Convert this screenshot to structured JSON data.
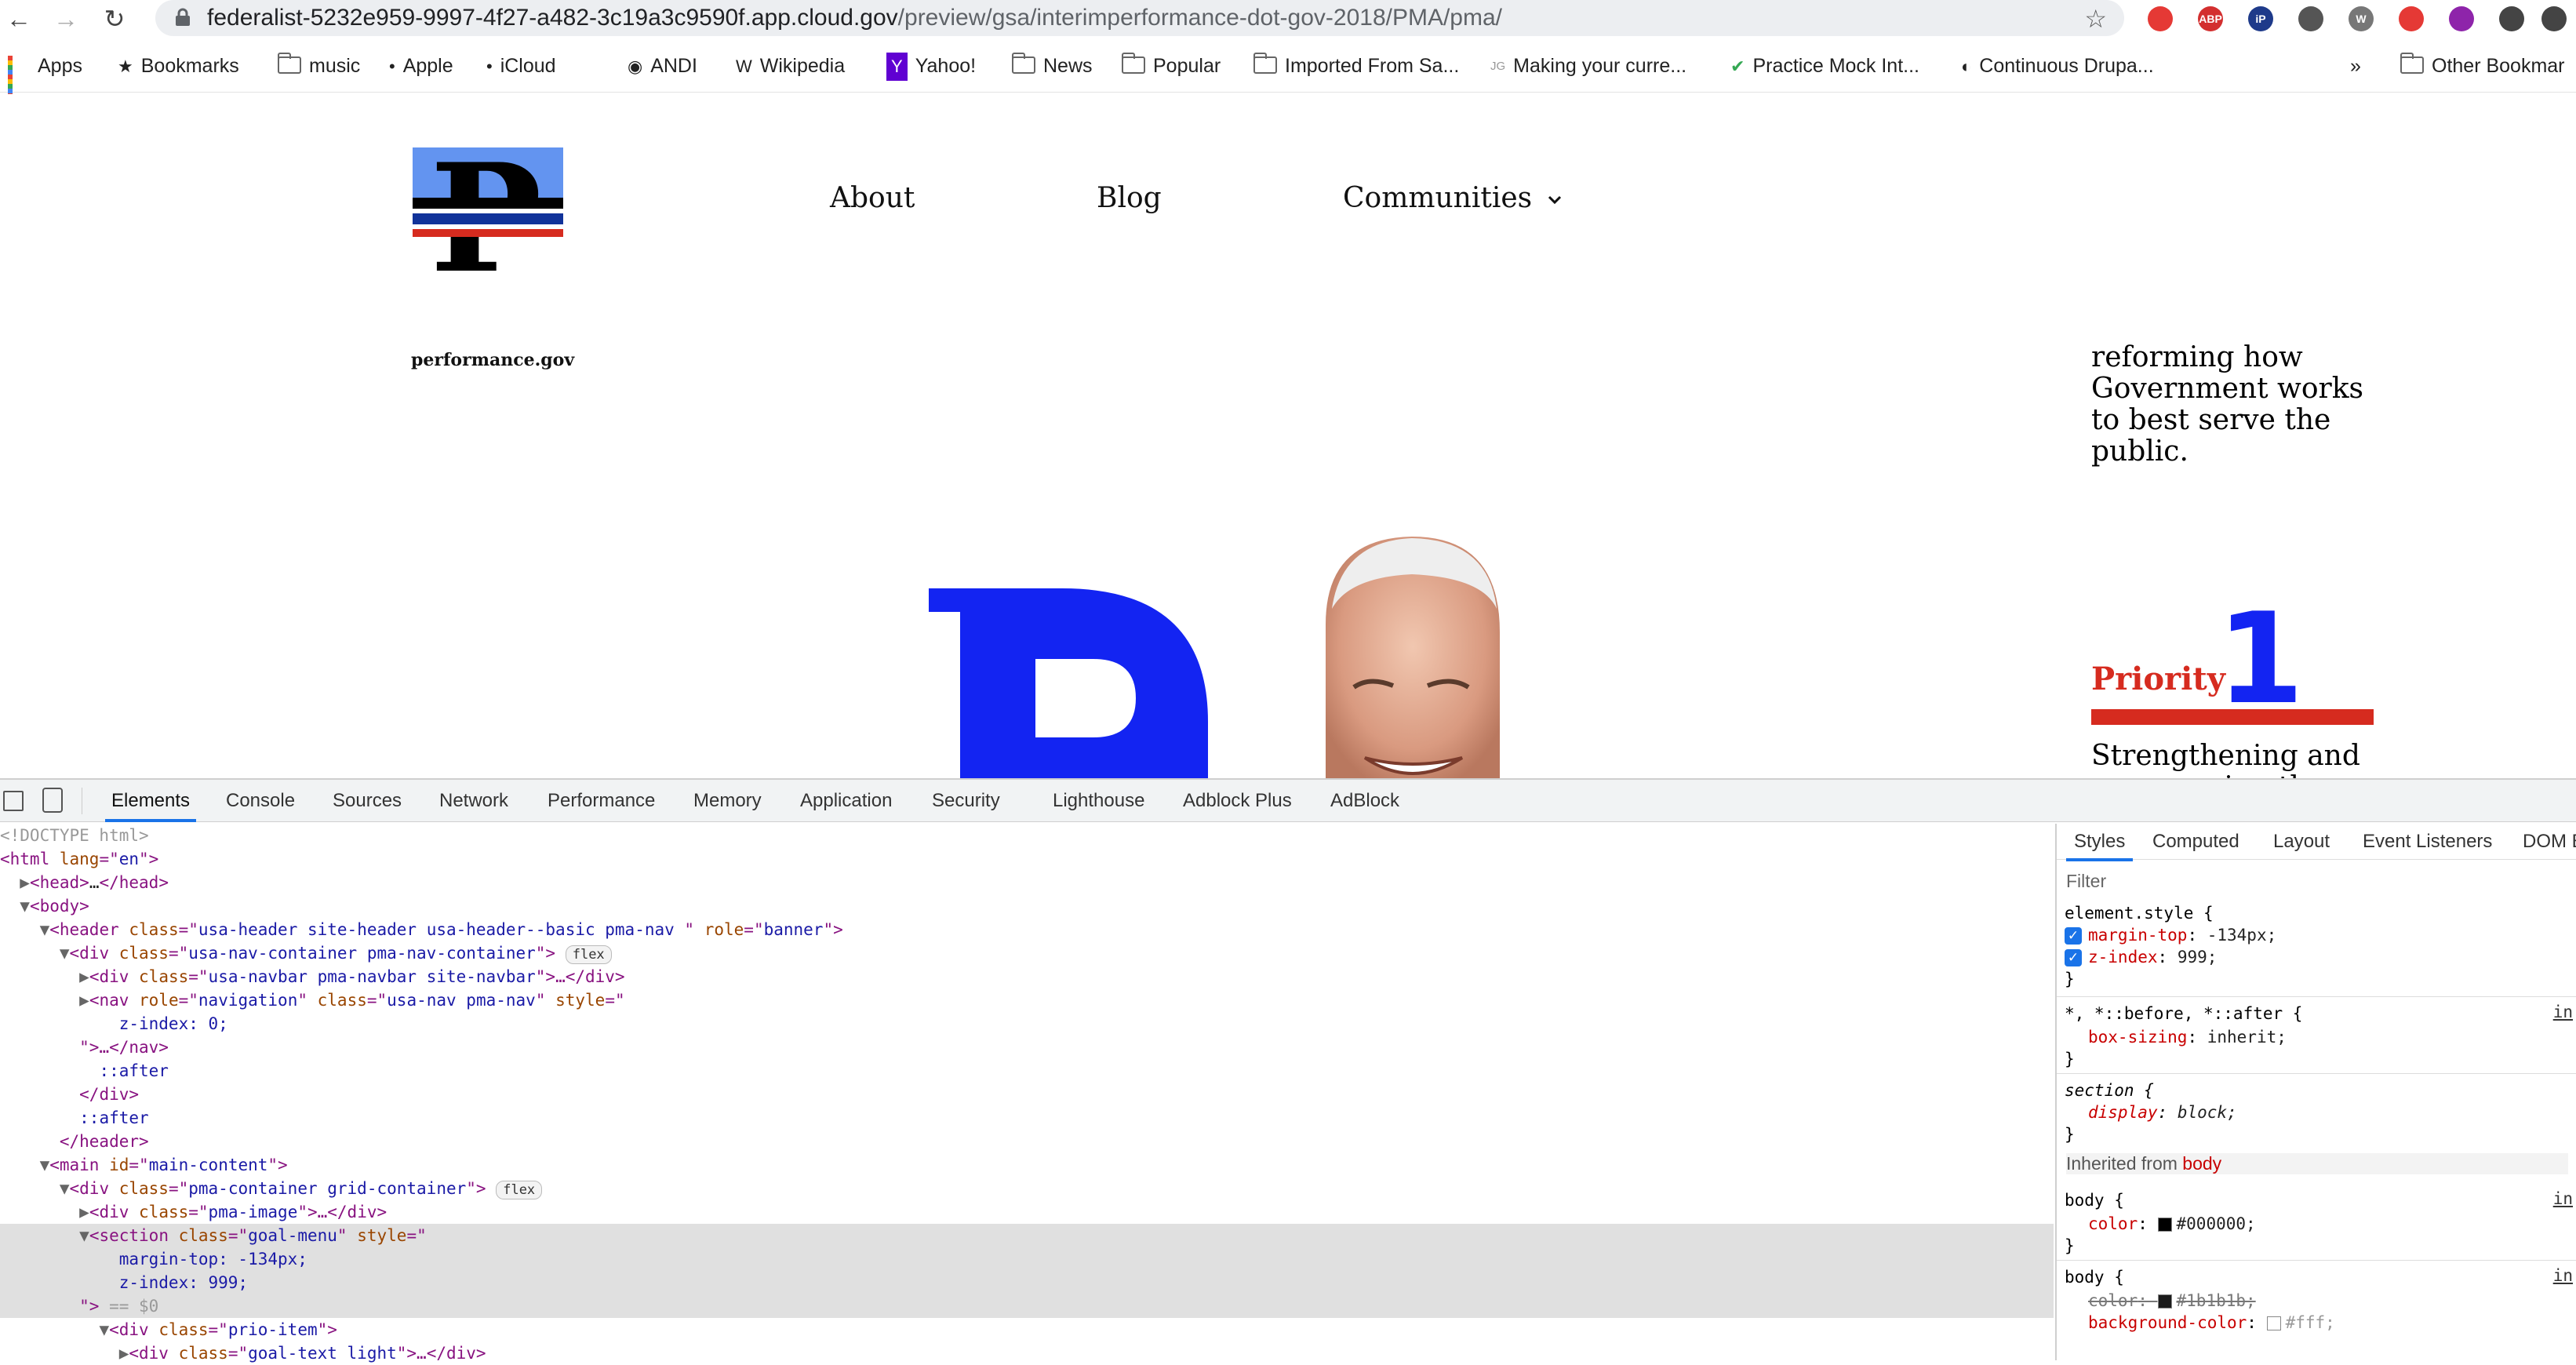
{
  "browser": {
    "url_host": "federalist-5232e959-9997-4f27-a482-3c19a3c9590f.app.cloud.gov",
    "url_path": "/preview/gsa/interimperformance-dot-gov-2018/PMA/pma/",
    "bookmarks": [
      {
        "label": "Apps",
        "icon": "apps-grid-icon"
      },
      {
        "label": "Bookmarks",
        "icon": "star-icon"
      },
      {
        "label": "music",
        "icon": "folder-icon"
      },
      {
        "label": "Apple",
        "icon": "apple-icon"
      },
      {
        "label": "iCloud",
        "icon": "apple-icon"
      },
      {
        "label": "ANDI",
        "icon": "globe-icon"
      },
      {
        "label": "Wikipedia",
        "icon": "wikipedia-icon"
      },
      {
        "label": "Yahoo!",
        "icon": "yahoo-icon"
      },
      {
        "label": "News",
        "icon": "folder-icon"
      },
      {
        "label": "Popular",
        "icon": "folder-icon"
      },
      {
        "label": "Imported From Sa...",
        "icon": "folder-icon"
      },
      {
        "label": "Making your curre...",
        "icon": "jg-icon"
      },
      {
        "label": "Practice Mock Int...",
        "icon": "check-circle-icon"
      },
      {
        "label": "Continuous Drupa...",
        "icon": "drupal-icon"
      }
    ],
    "overflow_label": "»",
    "other_bookmarks": "Other Bookmar",
    "extensions": [
      {
        "text": "",
        "color": "#e53935"
      },
      {
        "text": "ABP",
        "color": "#d32f2f"
      },
      {
        "text": "iP",
        "color": "#1e3a8a"
      },
      {
        "text": "",
        "color": "#555555"
      },
      {
        "text": "W",
        "color": "#777777"
      },
      {
        "text": "",
        "color": "#e53935"
      },
      {
        "text": "",
        "color": "#8e24aa"
      },
      {
        "text": "",
        "color": "#444444"
      },
      {
        "text": "",
        "color": "#444444"
      }
    ]
  },
  "site": {
    "logo_word": "performance.gov",
    "nav": [
      {
        "label": "About"
      },
      {
        "label": "Blog"
      },
      {
        "label": "Communities"
      }
    ],
    "goal_intro": "reforming how Government works to best serve the public.",
    "priority_word": "Priority",
    "priority_number": "1",
    "goal_title": "Strengthening and empowering the Federal workforce",
    "colors": {
      "blue": "#1324f2",
      "red": "#d62b1f",
      "logo_sky": "#6394f0"
    }
  },
  "devtools": {
    "tabs": [
      "Elements",
      "Console",
      "Sources",
      "Network",
      "Performance",
      "Memory",
      "Application",
      "Security",
      "Lighthouse",
      "Adblock Plus",
      "AdBlock"
    ],
    "active_tab": "Elements",
    "dom": {
      "doctype": "<!DOCTYPE html>",
      "html_lang": "en",
      "head_collapsed": "…",
      "header_class": "usa-header site-header usa-header--basic pma-nav ",
      "header_role": "banner",
      "nav_container_class": "usa-nav-container pma-nav-container",
      "flex_badge": "flex",
      "navbar_class": "usa-navbar pma-navbar site-navbar",
      "nav_role": "navigation",
      "nav_class": "usa-nav pma-nav",
      "nav_style": "z-index: 0;",
      "after": "::after",
      "main_id": "main-content",
      "pma_container_class": "pma-container grid-container",
      "pma_image_class": "pma-image",
      "section_class": "goal-menu",
      "section_style_1": "margin-top: -134px;",
      "section_style_2": "z-index: 999;",
      "selected_marker": "== $0",
      "prio_item_class": "prio-item",
      "goal_text_class": "goal-text light"
    },
    "styles_tabs": [
      "Styles",
      "Computed",
      "Layout",
      "Event Listeners",
      "DOM B"
    ],
    "filter_placeholder": "Filter",
    "rules": {
      "element_style": "element.style {",
      "margin_top_prop": "margin-top",
      "margin_top_val": "-134px;",
      "z_index_prop": "z-index",
      "z_index_val": "999;",
      "universal_selector": "*, *::before, *::after {",
      "box_sizing_prop": "box-sizing",
      "box_sizing_val": "inherit;",
      "section_selector": "section {",
      "display_prop": "display",
      "display_val": "block;",
      "inherited_label": "Inherited from ",
      "inherited_from": "body",
      "body_selector": "body {",
      "color_prop": "color",
      "color_val": "#000000;",
      "color_val_2": "#1b1b1b;",
      "bg_prop": "background-color",
      "bg_val": "#fff;",
      "close_brace": "}",
      "src_ref": "in"
    }
  }
}
